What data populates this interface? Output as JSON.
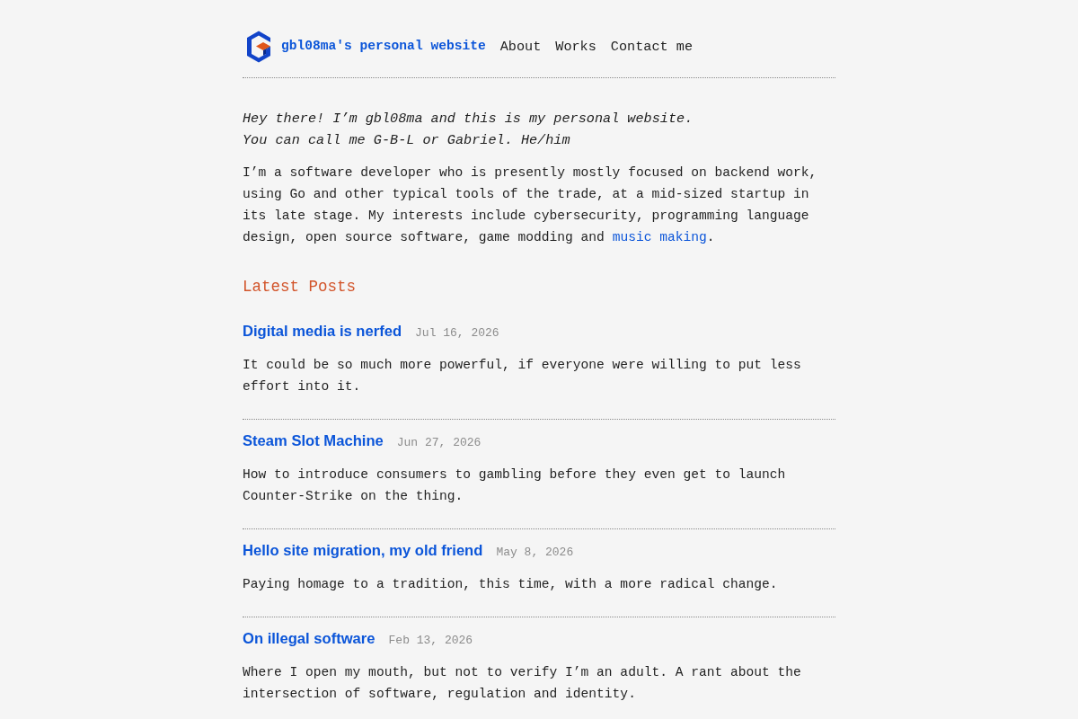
{
  "header": {
    "site_title": "gbl08ma's personal website",
    "nav": [
      {
        "label": "About"
      },
      {
        "label": "Works"
      },
      {
        "label": "Contact me"
      }
    ]
  },
  "intro": {
    "greeting": [
      "Hey there! I’m gbl08ma and this is my personal website.",
      "You can call me G-B-L or Gabriel. He/him"
    ],
    "bio": [
      {
        "kind": "text",
        "text": "I’m a software developer who is presently mostly focused on backend work, using Go and other typical tools of the trade, at a mid-sized startup in its late stage. My interests include cybersecurity, programming language design, open source software, game modding and "
      },
      {
        "kind": "link",
        "text": "music making"
      },
      {
        "kind": "text",
        "text": "."
      }
    ]
  },
  "latest_posts": {
    "heading": "Latest Posts",
    "posts": [
      {
        "title": "Digital media is nerfed",
        "date": "Jul 16, 2026",
        "summary": "It could be so much more powerful, if everyone were willing to put less effort into it."
      },
      {
        "title": "Steam Slot Machine",
        "date": "Jun 27, 2026",
        "summary": "How to introduce consumers to gambling before they even get to launch Counter-Strike on the thing."
      },
      {
        "title": "Hello site migration, my old friend",
        "date": "May 8, 2026",
        "summary": "Paying homage to a tradition, this time, with a more radical change."
      },
      {
        "title": "On illegal software",
        "date": "Feb 13, 2026",
        "summary": "Where I open my mouth, but not to verify I’m an adult. A rant about the intersection of software, regulation and identity."
      }
    ]
  }
}
